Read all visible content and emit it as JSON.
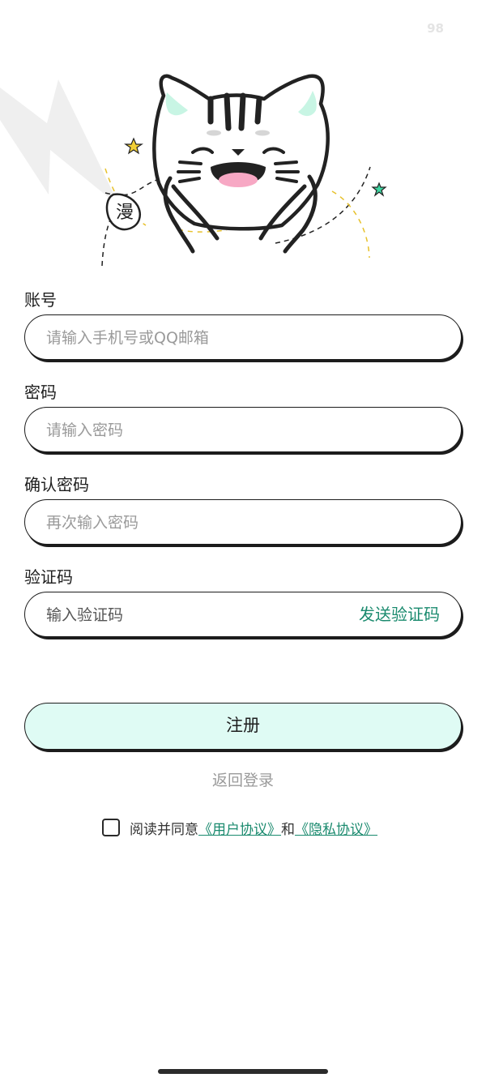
{
  "status": {
    "corner_number": "98"
  },
  "mascot": {
    "badge_char": "漫"
  },
  "form": {
    "account": {
      "label": "账号",
      "placeholder": "请输入手机号或QQ邮箱"
    },
    "password": {
      "label": "密码",
      "placeholder": "请输入密码"
    },
    "confirm_password": {
      "label": "确认密码",
      "placeholder": "再次输入密码"
    },
    "verify_code": {
      "label": "验证码",
      "placeholder": "输入验证码",
      "send_label": "发送验证码"
    }
  },
  "actions": {
    "register_label": "注册",
    "back_login_label": "返回登录"
  },
  "agreement": {
    "prefix": "阅读并同意",
    "user_agreement": "《用户协议》",
    "and": "和",
    "privacy_policy": "《隐私协议》",
    "checked": false
  },
  "colors": {
    "accent": "#1a8a6e",
    "button_bg": "#dffbf4",
    "placeholder": "#9a9a9a",
    "border": "#1c1c1c"
  }
}
